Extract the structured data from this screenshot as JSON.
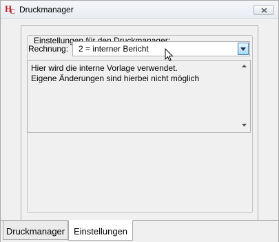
{
  "window": {
    "title": "Druckmanager"
  },
  "group": {
    "legend": "Einstellungen für den Druckmanager:"
  },
  "rechnung": {
    "label": "Rechnung:",
    "selected": "2 = interner Bericht"
  },
  "info": {
    "text": "Hier wird die interne Vorlage verwendet.\nEigene Änderungen sind hierbei nicht möglich"
  },
  "tabs": [
    {
      "label": "Druckmanager",
      "active": false
    },
    {
      "label": "Einstellungen",
      "active": true
    }
  ],
  "icons": {
    "app": "hc-app-icon",
    "close": "close-icon",
    "dropdown": "chevron-down-icon",
    "scroll_up": "scroll-up-arrow-icon",
    "scroll_down": "scroll-down-arrow-icon",
    "cursor": "mouse-cursor-icon"
  },
  "colors": {
    "app_icon": "#c0191f",
    "dropdown_button": "#a7d9f5"
  }
}
